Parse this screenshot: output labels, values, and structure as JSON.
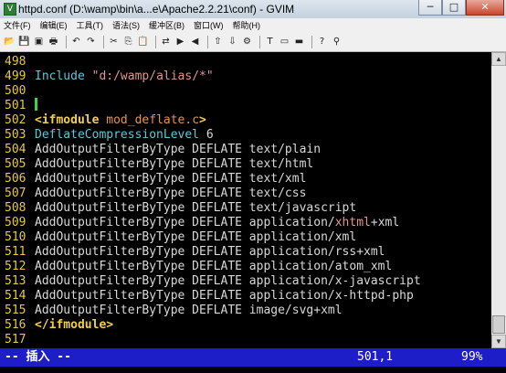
{
  "window": {
    "title": "httpd.conf (D:\\wamp\\bin\\a...e\\Apache2.2.21\\conf) - GVIM",
    "app_icon": "vim-icon",
    "buttons": [
      "minimize",
      "maximize",
      "close"
    ],
    "button_glyphs": [
      "─",
      "□",
      "✕"
    ]
  },
  "menu": [
    "文件(F)",
    "编辑(E)",
    "工具(T)",
    "语法(S)",
    "缓冲区(B)",
    "窗口(W)",
    "帮助(H)"
  ],
  "toolbar_icons": [
    "open-icon",
    "save-icon",
    "save-all-icon",
    "print-icon",
    "sep",
    "undo-icon",
    "redo-icon",
    "sep",
    "cut-icon",
    "copy-icon",
    "paste-icon",
    "sep",
    "find-replace-icon",
    "find-next-icon",
    "find-prev-icon",
    "sep",
    "load-session-icon",
    "save-session-icon",
    "run-script-icon",
    "sep",
    "make-icon",
    "shell-icon",
    "ctags-icon",
    "sep",
    "help-icon",
    "find-help-icon"
  ],
  "toolbar_glyphs": [
    "📂",
    "💾",
    "▣",
    "🖶",
    "",
    "↶",
    "↷",
    "",
    "✂",
    "⎘",
    "📋",
    "",
    "⇄",
    "▶",
    "◀",
    "",
    "⇧",
    "⇩",
    "⚙",
    "",
    "T",
    "▭",
    "▬",
    "",
    "?",
    "⚲"
  ],
  "editor": {
    "lines": [
      {
        "num": "498",
        "segments": []
      },
      {
        "num": "499",
        "segments": [
          {
            "text": "Include ",
            "cls": "kw"
          },
          {
            "text": "\"d:/wamp/alias/*\"",
            "cls": "str"
          }
        ]
      },
      {
        "num": "500",
        "segments": []
      },
      {
        "num": "501",
        "segments": [],
        "cursor": true
      },
      {
        "num": "502",
        "segments": [
          {
            "text": "<ifmodule ",
            "cls": "tag"
          },
          {
            "text": "mod_deflate.c",
            "cls": "mod"
          },
          {
            "text": ">",
            "cls": "tag"
          }
        ]
      },
      {
        "num": "503",
        "segments": [
          {
            "text": "DeflateCompressionLevel",
            "cls": "kw"
          },
          {
            "text": " 6",
            "cls": ""
          }
        ]
      },
      {
        "num": "504",
        "segments": [
          {
            "text": "AddOutputFilterByType DEFLATE text/plain",
            "cls": ""
          }
        ]
      },
      {
        "num": "505",
        "segments": [
          {
            "text": "AddOutputFilterByType DEFLATE text/html",
            "cls": ""
          }
        ]
      },
      {
        "num": "506",
        "segments": [
          {
            "text": "AddOutputFilterByType DEFLATE text/xml",
            "cls": ""
          }
        ]
      },
      {
        "num": "507",
        "segments": [
          {
            "text": "AddOutputFilterByType DEFLATE text/css",
            "cls": ""
          }
        ]
      },
      {
        "num": "508",
        "segments": [
          {
            "text": "AddOutputFilterByType DEFLATE text/javascript",
            "cls": ""
          }
        ]
      },
      {
        "num": "509",
        "segments": [
          {
            "text": "AddOutputFilterByType DEFLATE application/",
            "cls": ""
          },
          {
            "text": "xhtml",
            "cls": "str"
          },
          {
            "text": "+xml",
            "cls": ""
          }
        ]
      },
      {
        "num": "510",
        "segments": [
          {
            "text": "AddOutputFilterByType DEFLATE application/xml",
            "cls": ""
          }
        ]
      },
      {
        "num": "511",
        "segments": [
          {
            "text": "AddOutputFilterByType DEFLATE application/rss+xml",
            "cls": ""
          }
        ]
      },
      {
        "num": "512",
        "segments": [
          {
            "text": "AddOutputFilterByType DEFLATE application/atom_xml",
            "cls": ""
          }
        ]
      },
      {
        "num": "513",
        "segments": [
          {
            "text": "AddOutputFilterByType DEFLATE application/x-javascript",
            "cls": ""
          }
        ]
      },
      {
        "num": "514",
        "segments": [
          {
            "text": "AddOutputFilterByType DEFLATE application/x-httpd-php",
            "cls": ""
          }
        ]
      },
      {
        "num": "515",
        "segments": [
          {
            "text": "AddOutputFilterByType DEFLATE image/svg+xml",
            "cls": ""
          }
        ]
      },
      {
        "num": "516",
        "segments": [
          {
            "text": "</ifmodule>",
            "cls": "tag"
          }
        ]
      },
      {
        "num": "517",
        "segments": []
      }
    ]
  },
  "scrollbar": {
    "up": "▲",
    "down": "▼",
    "position": 0.99
  },
  "status": {
    "mode": "-- 插入 --",
    "position": "501,1",
    "percent": "99%"
  },
  "colors": {
    "line_number": "#e8c93a",
    "keyword": "#5ec8d3",
    "string": "#e0968c",
    "tag": "#f1d04c",
    "status_bg": "#1e1ec8",
    "cursor": "#39d34c"
  }
}
